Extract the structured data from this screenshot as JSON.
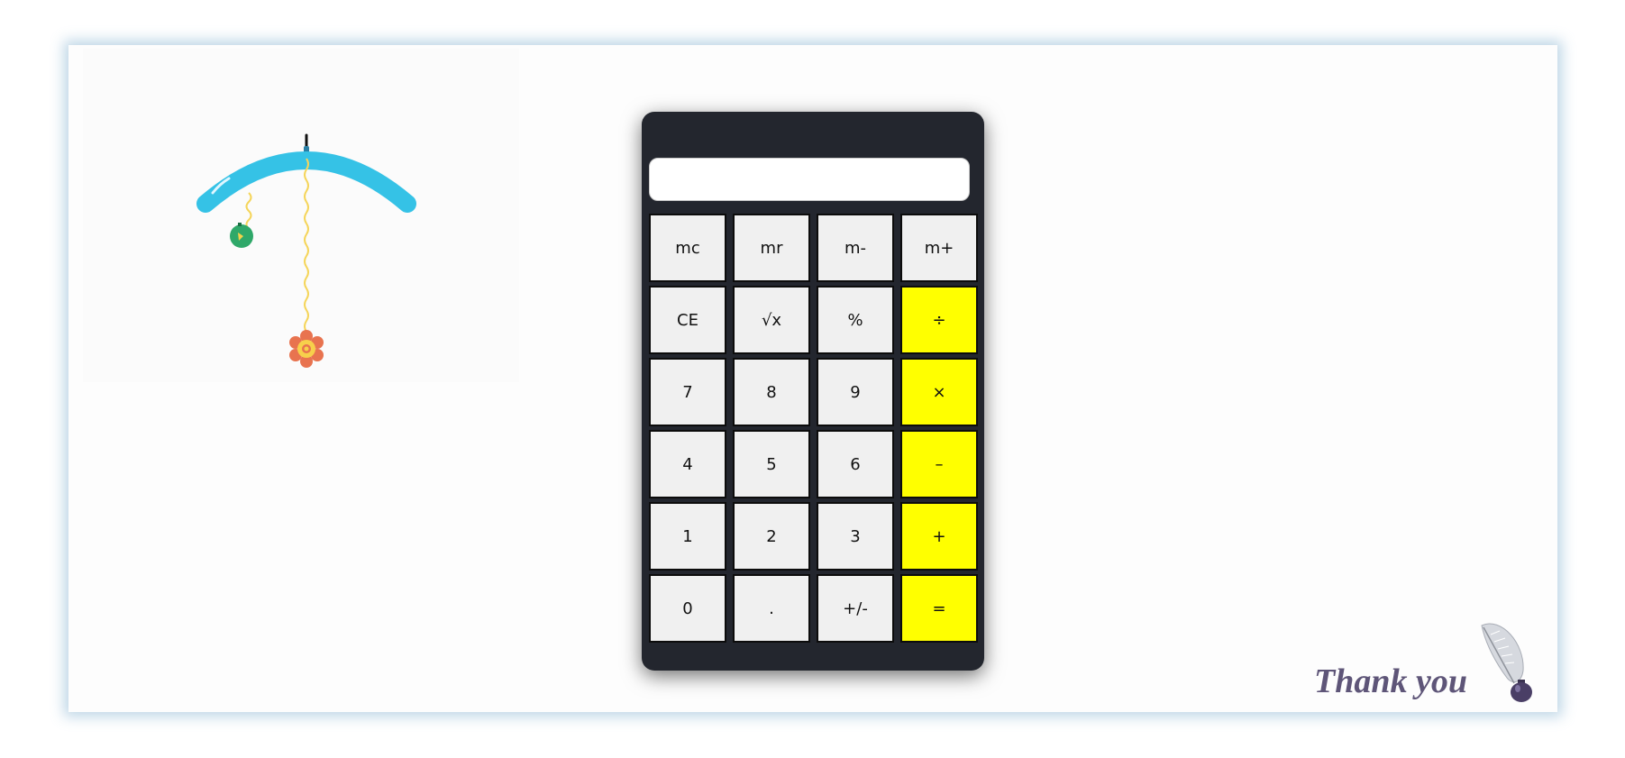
{
  "calculator": {
    "display_value": "",
    "keys": [
      {
        "label": "mc",
        "name": "key-mc",
        "type": "num"
      },
      {
        "label": "mr",
        "name": "key-mr",
        "type": "num"
      },
      {
        "label": "m-",
        "name": "key-m-minus",
        "type": "num"
      },
      {
        "label": "m+",
        "name": "key-m-plus",
        "type": "num"
      },
      {
        "label": "CE",
        "name": "key-ce",
        "type": "num"
      },
      {
        "label": "√x",
        "name": "key-sqrt",
        "type": "num"
      },
      {
        "label": "%",
        "name": "key-percent",
        "type": "num"
      },
      {
        "label": "÷",
        "name": "key-divide",
        "type": "op"
      },
      {
        "label": "7",
        "name": "key-7",
        "type": "num"
      },
      {
        "label": "8",
        "name": "key-8",
        "type": "num"
      },
      {
        "label": "9",
        "name": "key-9",
        "type": "num"
      },
      {
        "label": "×",
        "name": "key-multiply",
        "type": "op"
      },
      {
        "label": "4",
        "name": "key-4",
        "type": "num"
      },
      {
        "label": "5",
        "name": "key-5",
        "type": "num"
      },
      {
        "label": "6",
        "name": "key-6",
        "type": "num"
      },
      {
        "label": "–",
        "name": "key-subtract",
        "type": "op"
      },
      {
        "label": "1",
        "name": "key-1",
        "type": "num"
      },
      {
        "label": "2",
        "name": "key-2",
        "type": "num"
      },
      {
        "label": "3",
        "name": "key-3",
        "type": "num"
      },
      {
        "label": "+",
        "name": "key-add",
        "type": "op"
      },
      {
        "label": "0",
        "name": "key-0",
        "type": "num"
      },
      {
        "label": ".",
        "name": "key-decimal",
        "type": "num"
      },
      {
        "label": "+/-",
        "name": "key-negate",
        "type": "num"
      },
      {
        "label": "=",
        "name": "key-equals",
        "type": "op"
      }
    ]
  },
  "footer": {
    "thank_you_text": "Thank you",
    "quill_icon": "quill-icon",
    "inkwell_icon": "inkwell-icon"
  },
  "illustration": {
    "icon": "hanging-mobile-icon"
  },
  "colors": {
    "calculator_body": "#23262e",
    "operator_key": "#ffff00",
    "number_key": "#f0f0f0",
    "mobile_arc": "#35c2e6",
    "thank_you_text": "#5e5578"
  }
}
